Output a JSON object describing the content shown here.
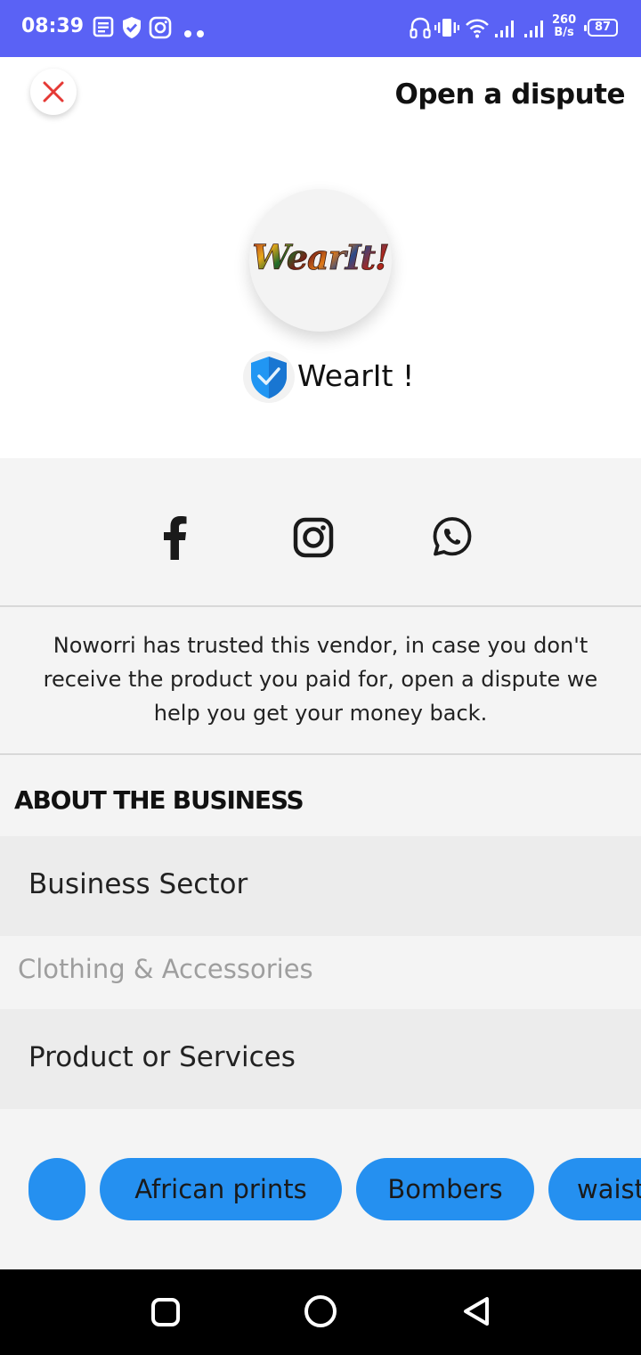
{
  "status_bar": {
    "time": "08:39",
    "network_speed_value": "260",
    "network_speed_unit": "B/s",
    "battery": "87",
    "icons": [
      "news-icon",
      "shield-icon",
      "instagram-icon",
      "dots-icon",
      "headphones-icon",
      "vibrate-icon",
      "wifi-icon",
      "signal-icon",
      "signal-icon",
      "battery-icon"
    ]
  },
  "header": {
    "close_icon": "close-icon",
    "dispute_label": "Open a dispute"
  },
  "vendor": {
    "logo_text": "WearIt!",
    "verified_icon": "verified-shield-icon",
    "name": "WearIt !"
  },
  "social": {
    "icons": [
      "facebook-icon",
      "instagram-icon",
      "whatsapp-icon"
    ]
  },
  "trust_message": "Noworri has trusted this vendor, in case you don't receive the product you paid for, open a dispute we help you get your money back.",
  "about": {
    "title": "ABOUT THE BUSINESS",
    "sector_label": "Business Sector",
    "sector_value": "Clothing & Accessories",
    "products_label": "Product or Services",
    "products": [
      "",
      "African prints",
      "Bombers",
      "waist"
    ]
  },
  "colors": {
    "status_bar": "#5a62f5",
    "chip": "#2590f0",
    "close_x": "#e53935",
    "verified": "#2196f3"
  },
  "nav_bar": {
    "icons": [
      "recents-icon",
      "home-icon",
      "back-icon"
    ]
  }
}
